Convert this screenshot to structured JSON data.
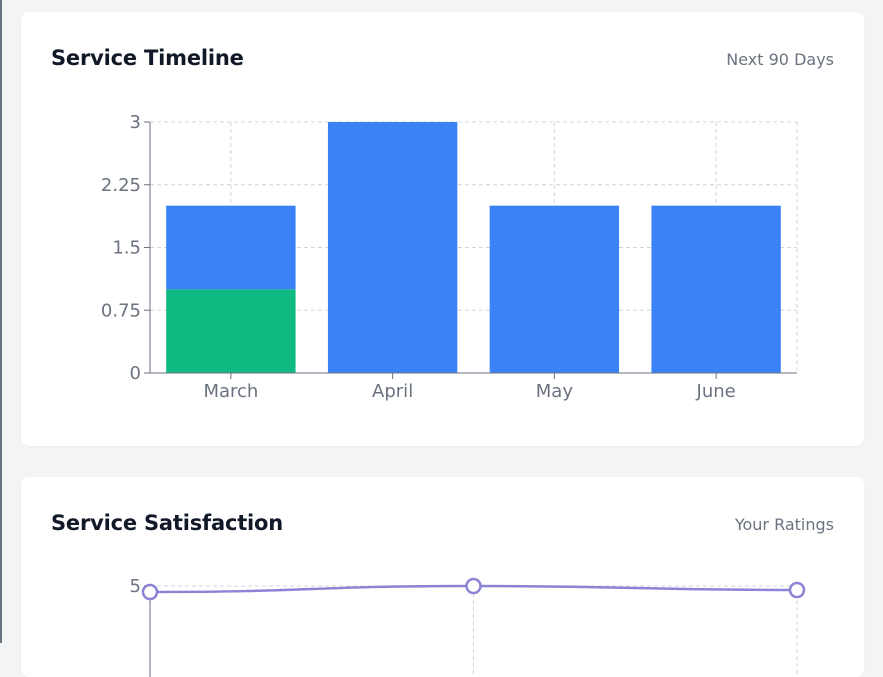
{
  "service_timeline": {
    "title": "Service Timeline",
    "subtitle": "Next 90 Days"
  },
  "service_satisfaction": {
    "title": "Service Satisfaction",
    "subtitle": "Your Ratings"
  },
  "colors": {
    "scheduled": "#3b82f6",
    "completed": "#10b981",
    "rating_line": "#8b83d4"
  },
  "chart_data": [
    {
      "type": "bar",
      "stacked": true,
      "categories": [
        "March",
        "April",
        "May",
        "June"
      ],
      "series": [
        {
          "values": [
            1,
            0,
            0,
            0
          ],
          "color": "#10b981"
        },
        {
          "values": [
            1,
            3,
            2,
            2
          ],
          "color": "#3b82f6"
        }
      ],
      "ylim": [
        0,
        3
      ],
      "yticks": [
        "0",
        "0.75",
        "1.5",
        "2.25",
        "3"
      ],
      "grid": true,
      "xlabel": "",
      "ylabel": ""
    },
    {
      "type": "line",
      "x": [
        "",
        "",
        ""
      ],
      "series": [
        {
          "values": [
            4.85,
            5,
            4.9
          ],
          "color": "#8b83d4"
        }
      ],
      "yticks_visible": [
        "5"
      ],
      "grid": true,
      "xlabel": "",
      "ylabel": ""
    }
  ]
}
